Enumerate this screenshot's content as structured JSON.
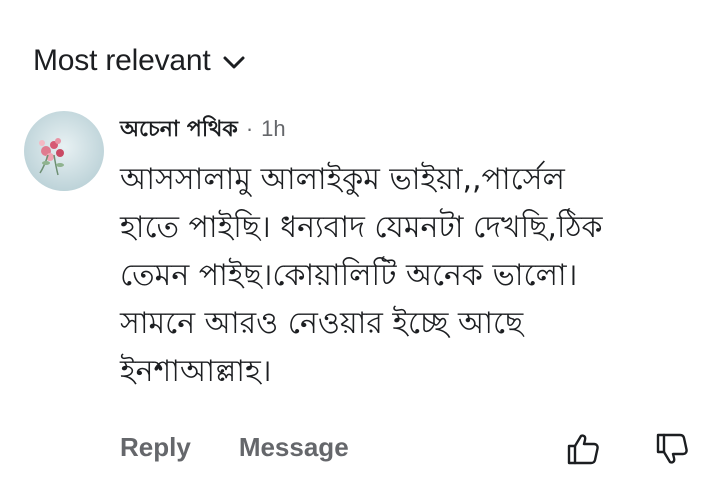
{
  "sort": {
    "label": "Most relevant",
    "icon": "chevron-down-icon"
  },
  "comment": {
    "author": "অচেনা পথিক",
    "separator": "·",
    "timestamp": "1h",
    "text": "আসসালামু আলাইকুম ভাইয়া,,পার্সেল\nহাতে পাইছি। ধন্যবাদ যেমনটা দেখছি,ঠিক\nতেমন পাইছ।কোয়ালিটি অনেক ভালো।\nসামনে আরও নেওয়ার ইচ্ছে আছে\nইনশাআল্লাহ।",
    "avatar_icon": "flower-avatar-icon"
  },
  "actions": {
    "reply": "Reply",
    "message": "Message",
    "like_icon": "thumbs-up-icon",
    "dislike_icon": "thumbs-down-icon"
  },
  "colors": {
    "text_primary": "#1c1e21",
    "text_secondary": "#65676b",
    "background": "#ffffff"
  }
}
